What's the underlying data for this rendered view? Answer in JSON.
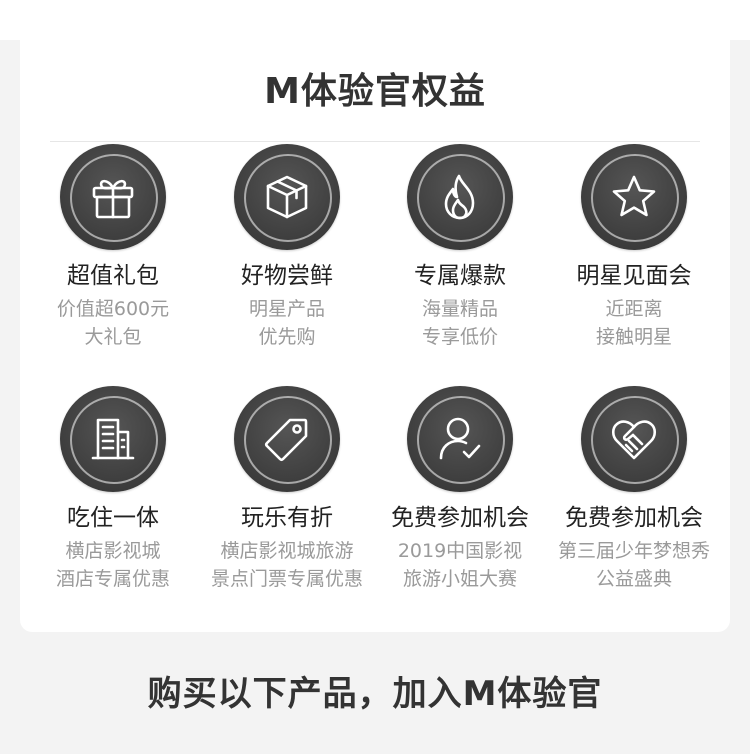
{
  "section_title": "M体验官权益",
  "benefits": [
    {
      "icon": "gift-icon",
      "title": "超值礼包",
      "desc1": "价值超600元",
      "desc2": "大礼包"
    },
    {
      "icon": "box-icon",
      "title": "好物尝鲜",
      "desc1": "明星产品",
      "desc2": "优先购"
    },
    {
      "icon": "flame-icon",
      "title": "专属爆款",
      "desc1": "海量精品",
      "desc2": "专享低价"
    },
    {
      "icon": "star-icon",
      "title": "明星见面会",
      "desc1": "近距离",
      "desc2": "接触明星"
    },
    {
      "icon": "building-icon",
      "title": "吃住一体",
      "desc1": "横店影视城",
      "desc2": "酒店专属优惠"
    },
    {
      "icon": "tag-icon",
      "title": "玩乐有折",
      "desc1": "横店影视城旅游",
      "desc2": "景点门票专属优惠"
    },
    {
      "icon": "user-check-icon",
      "title": "免费参加机会",
      "desc1": "2019中国影视",
      "desc2": "旅游小姐大赛"
    },
    {
      "icon": "heart-hands-icon",
      "title": "免费参加机会",
      "desc1": "第三届少年梦想秀",
      "desc2": "公益盛典"
    }
  ],
  "cta_title": "购买以下产品，加入M体验官"
}
